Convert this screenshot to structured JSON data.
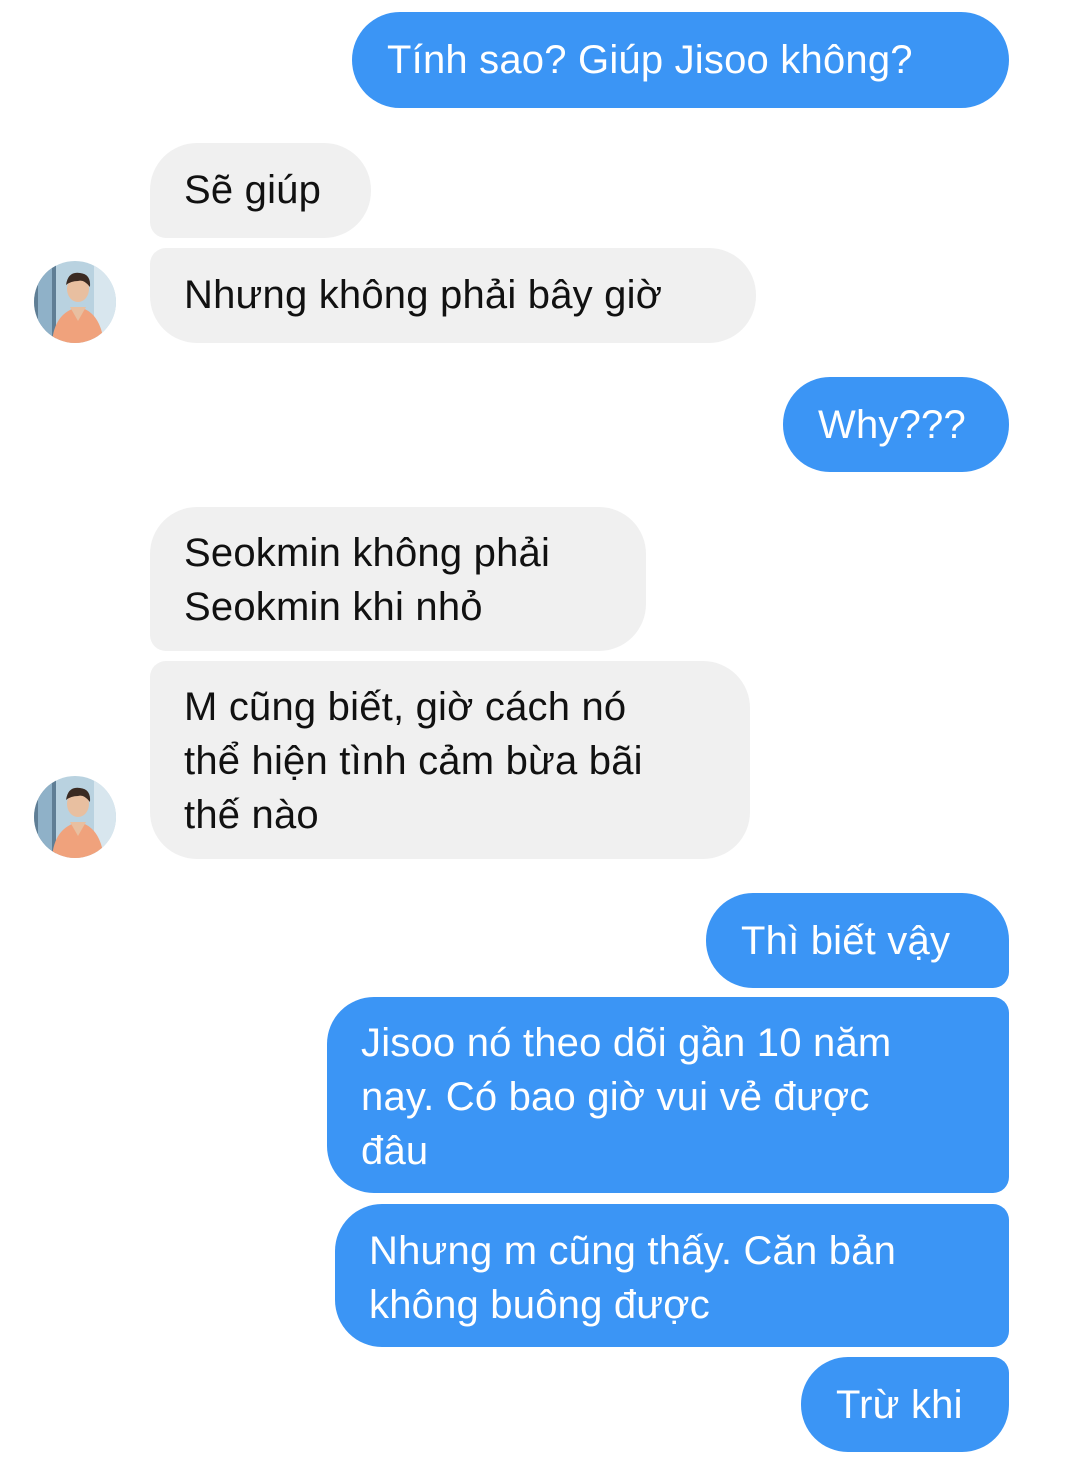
{
  "conversation": {
    "messages": [
      {
        "id": "m1",
        "side": "sent",
        "text": "Tính sao? Giúp Jisoo không?"
      },
      {
        "id": "m2",
        "side": "received",
        "text": "Sẽ giúp"
      },
      {
        "id": "m3",
        "side": "received",
        "text": "Nhưng không phải bây giờ"
      },
      {
        "id": "m4",
        "side": "sent",
        "text": "Why???"
      },
      {
        "id": "m5",
        "side": "received",
        "text": "Seokmin không phải\nSeokmin khi nhỏ"
      },
      {
        "id": "m6",
        "side": "received",
        "text": "M cũng biết, giờ cách nó\nthể hiện tình cảm bừa bãi\nthế nào"
      },
      {
        "id": "m7",
        "side": "sent",
        "text": "Thì biết vậy"
      },
      {
        "id": "m8",
        "side": "sent",
        "text": "Jisoo nó theo dõi gần 10 năm\nnay. Có bao giờ vui vẻ được\nđâu"
      },
      {
        "id": "m9",
        "side": "sent",
        "text": "Nhưng m cũng thấy. Căn bản\nkhông buông được"
      },
      {
        "id": "m10",
        "side": "sent",
        "text": "Trừ khi"
      }
    ]
  },
  "theme": {
    "sent_bubble_color": "#3b95f5",
    "received_bubble_color": "#f0f0f0",
    "avatar_icon": "contact-avatar-photo"
  }
}
